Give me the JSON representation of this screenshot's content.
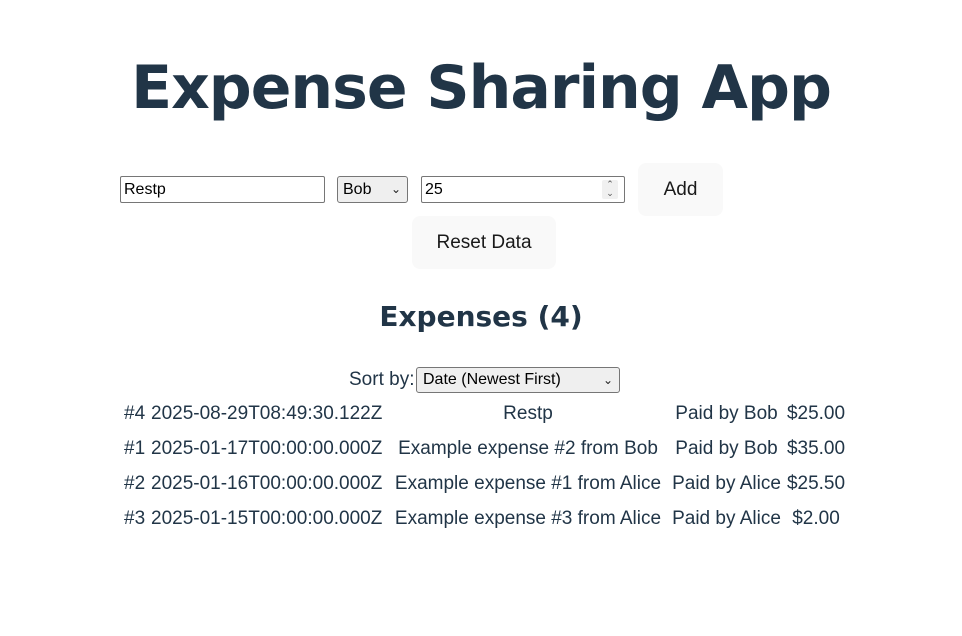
{
  "header": {
    "title": "Expense Sharing App"
  },
  "form": {
    "description_value": "Restp",
    "payer_selected": "Bob",
    "amount_value": "25",
    "add_label": "Add",
    "reset_label": "Reset Data"
  },
  "expenses": {
    "heading": "Expenses (4)",
    "sort_label": "Sort by:",
    "sort_selected": "Date (Newest First)",
    "rows": [
      {
        "index": "#4",
        "date": "2025-08-29T08:49:30.122Z",
        "description": "Restp",
        "paid_by": "Paid by Bob",
        "amount": "$25.00"
      },
      {
        "index": "#1",
        "date": "2025-01-17T00:00:00.000Z",
        "description": "Example expense #2 from Bob",
        "paid_by": "Paid by Bob",
        "amount": "$35.00"
      },
      {
        "index": "#2",
        "date": "2025-01-16T00:00:00.000Z",
        "description": "Example expense #1 from Alice",
        "paid_by": "Paid by Alice",
        "amount": "$25.50"
      },
      {
        "index": "#3",
        "date": "2025-01-15T00:00:00.000Z",
        "description": "Example expense #3 from Alice",
        "paid_by": "Paid by Alice",
        "amount": "$2.00"
      }
    ]
  },
  "icons": {
    "select_chevron": "chevron-down-icon",
    "spinner": "number-spinner-icon"
  }
}
